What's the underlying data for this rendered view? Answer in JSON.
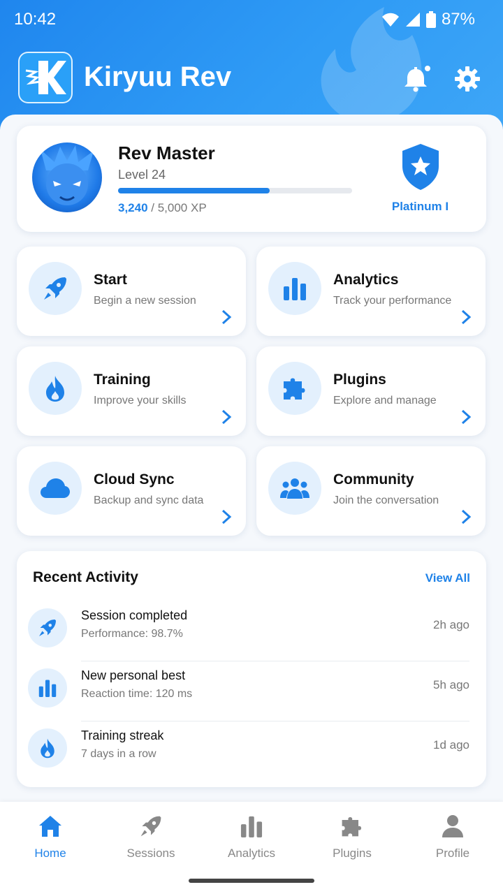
{
  "status": {
    "time": "10:42",
    "battery": "87%"
  },
  "app": {
    "title": "Kiryuu Rev",
    "logo_letter": "K"
  },
  "profile": {
    "rank": "Rev Master",
    "level": "Level 24",
    "xp_current": "3,240",
    "xp_total": " / 5,000 XP",
    "xp_fraction": 0.648,
    "badge": "Platinum I"
  },
  "tiles": [
    {
      "title": "Start",
      "subtitle": "Begin a new session",
      "icon": "rocket-icon"
    },
    {
      "title": "Analytics",
      "subtitle": "Track your performance",
      "icon": "bar-chart-icon"
    },
    {
      "title": "Training",
      "subtitle": "Improve your skills",
      "icon": "flame-icon"
    },
    {
      "title": "Plugins",
      "subtitle": "Explore and manage",
      "icon": "puzzle-icon"
    },
    {
      "title": "Cloud Sync",
      "subtitle": "Backup and sync data",
      "icon": "cloud-icon"
    },
    {
      "title": "Community",
      "subtitle": "Join the conversation",
      "icon": "people-icon"
    }
  ],
  "activity": {
    "heading": "Recent Activity",
    "view_all": "View All",
    "items": [
      {
        "title": "Session completed",
        "subtitle": "Performance: 98.7%",
        "time": "2h ago",
        "icon": "rocket-icon"
      },
      {
        "title": "New personal best",
        "subtitle": "Reaction time: 120 ms",
        "time": "5h ago",
        "icon": "bar-chart-icon"
      },
      {
        "title": "Training streak",
        "subtitle": "7 days in a row",
        "time": "1d ago",
        "icon": "flame-icon"
      }
    ]
  },
  "nav": [
    {
      "label": "Home",
      "icon": "home-icon",
      "active": true
    },
    {
      "label": "Sessions",
      "icon": "rocket-icon",
      "active": false
    },
    {
      "label": "Analytics",
      "icon": "bar-chart-icon",
      "active": false
    },
    {
      "label": "Plugins",
      "icon": "puzzle-icon",
      "active": false
    },
    {
      "label": "Profile",
      "icon": "person-icon",
      "active": false
    }
  ],
  "colors": {
    "accent": "#1f82e8",
    "header": "#2f9bf5",
    "icon_bg": "#e3f0fd"
  }
}
